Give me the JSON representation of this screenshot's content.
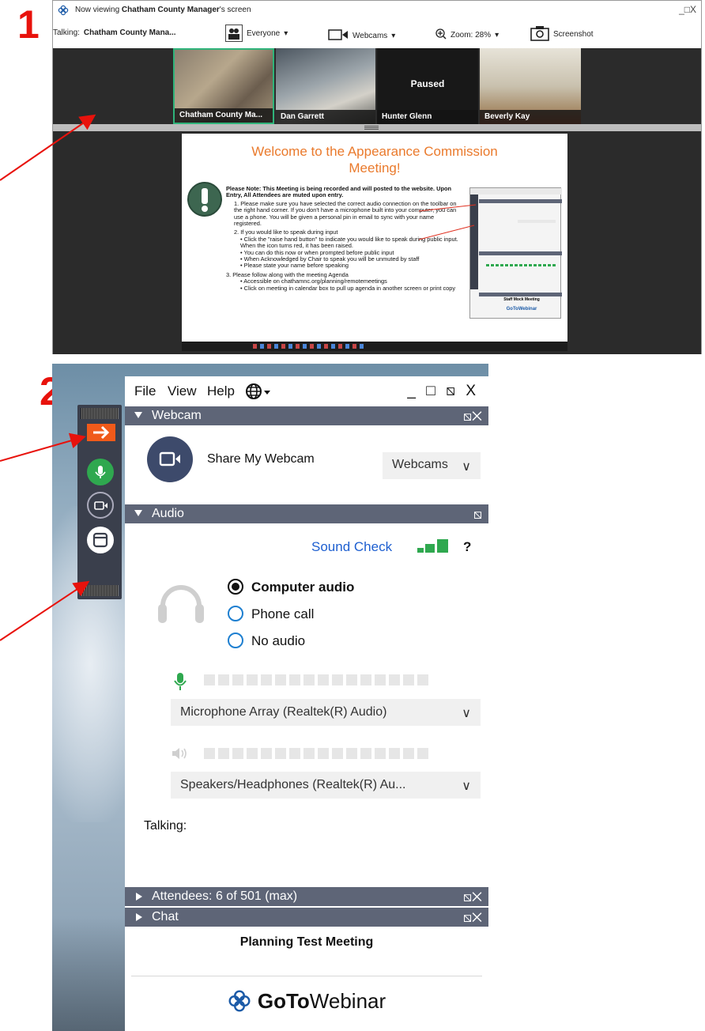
{
  "labels": {
    "step1": "1",
    "step2": "2"
  },
  "viewer": {
    "title_prefix": "Now viewing ",
    "title_name": "Chatham County Manager",
    "title_suffix": "'s screen",
    "window_controls": "_□X",
    "talking_label": "Talking:",
    "talking_name": "Chatham County Mana...",
    "audience": "Everyone",
    "webcams": "Webcams",
    "zoom": "Zoom: 28%",
    "screenshot": "Screenshot",
    "tiles": [
      {
        "name": "Chatham County Ma..."
      },
      {
        "name": "Dan Garrett"
      },
      {
        "name": "Hunter Glenn",
        "status": "Paused"
      },
      {
        "name": "Beverly Kay"
      }
    ],
    "slide": {
      "title_line1": "Welcome to the Appearance Commission",
      "title_line2": "Meeting!",
      "note": "Please Note: This Meeting is being recorded and will posted to the website. Upon Entry, All Attendees are muted upon entry.",
      "item1": "1.  Please make sure you have selected the correct audio connection on the toolbar on the right hand corner. If you don't have a microphone built into your computer, you can use a phone. You will be given a personal pin in email to sync with your name registered.",
      "item2": "2.  If you would like to speak during input",
      "item2_bullets": [
        "• Click the \"raise hand button\" to indicate you would like to speak during public input. When the icon turns red, it has been raised.",
        "• You can do this now or when prompted before public input",
        "• When Acknowledged by Chair to speak you will be unmuted by staff",
        "• Please state your name before speaking"
      ],
      "item3": "3. Please follow along with the meeting Agenda",
      "item3_bullets": [
        "• Accessible on chathamnc.org/planning/remotemeetings",
        "• Click on meeting in calendar box to pull up agenda in another screen or print copy"
      ],
      "thumb_meeting": "Staff Mock Meeting",
      "thumb_brand": "GoToWebinar"
    }
  },
  "panel": {
    "menu": {
      "file": "File",
      "view": "View",
      "help": "Help"
    },
    "window_controls": "_ □ ⧅ X",
    "webcam_section": {
      "title": "Webcam",
      "share": "Share My Webcam",
      "dropdown": "Webcams"
    },
    "audio_section": {
      "title": "Audio",
      "sound_check": "Sound Check",
      "help": "?",
      "options": {
        "computer": "Computer audio",
        "phone": "Phone call",
        "none": "No audio"
      },
      "selected": "Computer audio",
      "microphone": "Microphone Array (Realtek(R) Audio)",
      "speakers": "Speakers/Headphones  (Realtek(R)  Au...",
      "talking": "Talking:"
    },
    "attendees": "Attendees:  6 of 501 (max)",
    "chat": "Chat",
    "meeting_name": "Planning Test Meeting",
    "brand_goto": "GoTo",
    "brand_webinar": "Webinar"
  },
  "colors": {
    "accent_red": "#e8120c",
    "mic_green": "#2fa84f",
    "link_blue": "#1e5fd0",
    "orange": "#ea7a2c",
    "header": "#5e6577"
  }
}
